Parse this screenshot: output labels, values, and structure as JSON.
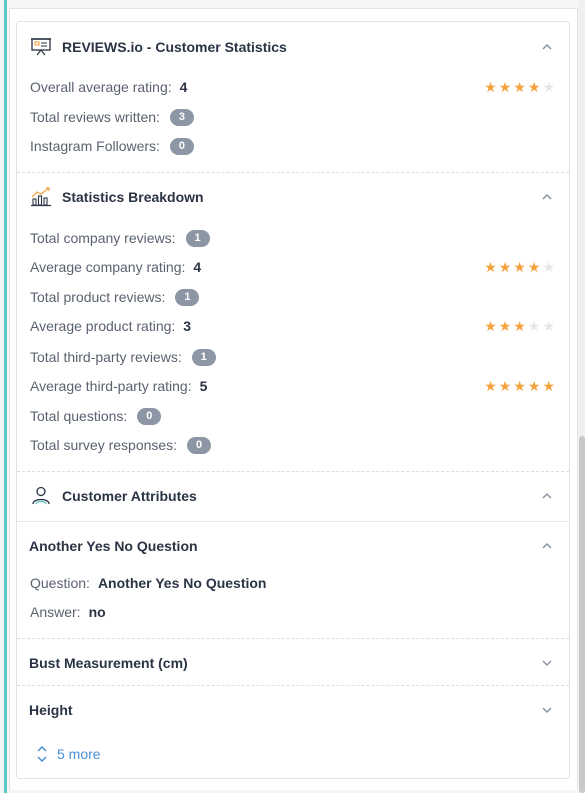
{
  "reviews_stats": {
    "title": "REVIEWS.io - Customer Statistics",
    "rows": [
      {
        "label": "Overall average rating:",
        "value": "4",
        "stars": 4
      },
      {
        "label": "Total reviews written:",
        "badge": "3"
      },
      {
        "label": "Instagram Followers:",
        "badge": "0"
      }
    ]
  },
  "breakdown": {
    "title": "Statistics Breakdown",
    "rows": [
      {
        "label": "Total company reviews:",
        "badge": "1"
      },
      {
        "label": "Average company rating:",
        "value": "4",
        "stars": 4
      },
      {
        "label": "Total product reviews:",
        "badge": "1"
      },
      {
        "label": "Average product rating:",
        "value": "3",
        "stars": 3
      },
      {
        "label": "Total third-party reviews:",
        "badge": "1"
      },
      {
        "label": "Average third-party rating:",
        "value": "5",
        "stars": 5
      },
      {
        "label": "Total questions:",
        "badge": "0"
      },
      {
        "label": "Total survey responses:",
        "badge": "0"
      }
    ]
  },
  "attributes": {
    "title": "Customer Attributes",
    "expanded_item": {
      "title": "Another Yes No Question",
      "question_label": "Question:",
      "question_value": "Another Yes No Question",
      "answer_label": "Answer:",
      "answer_value": "no"
    },
    "collapsed_items": [
      "Bust Measurement (cm)",
      "Height"
    ],
    "more_label": "5 more"
  },
  "colors": {
    "accent": "#5cc8bf",
    "star_on": "#f5a23c",
    "star_off": "#e4e6ea",
    "link": "#4a90d9",
    "badge": "#8c96a4"
  },
  "icons": {
    "reviews": "presentation-board-icon",
    "breakdown": "bar-chart-trend-icon",
    "attributes": "user-profile-icon",
    "collapse": "chevron-up-icon",
    "expand": "chevron-down-icon",
    "more": "expand-vertical-icon"
  }
}
